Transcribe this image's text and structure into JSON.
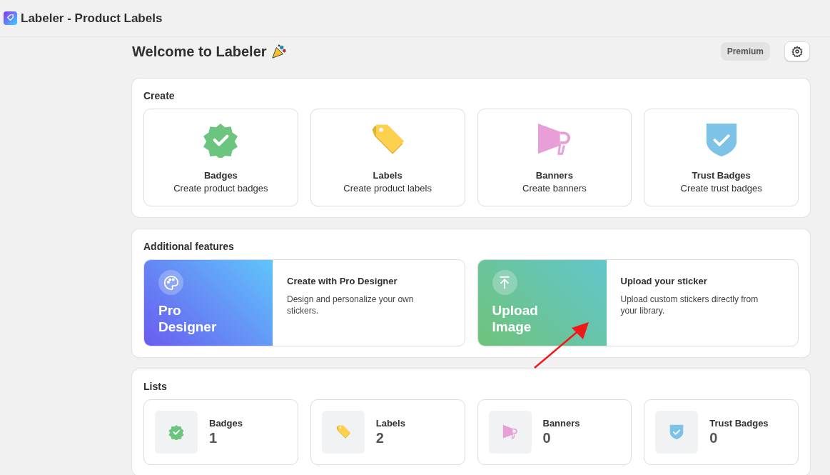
{
  "app_bar": {
    "title": "Labeler - Product Labels"
  },
  "header": {
    "title": "Welcome to Labeler",
    "plan_badge": "Premium"
  },
  "create": {
    "title": "Create",
    "items": [
      {
        "kind": "badge",
        "title": "Badges",
        "subtitle": "Create product badges"
      },
      {
        "kind": "label",
        "title": "Labels",
        "subtitle": "Create product labels"
      },
      {
        "kind": "banner",
        "title": "Banners",
        "subtitle": "Create banners"
      },
      {
        "kind": "trust",
        "title": "Trust Badges",
        "subtitle": "Create trust badges"
      }
    ]
  },
  "additional_features": {
    "title": "Additional features",
    "items": [
      {
        "kind": "designer",
        "tile_label": "Pro Designer",
        "title": "Create with Pro Designer",
        "description": "Design and personalize your own stickers."
      },
      {
        "kind": "upload",
        "tile_label": "Upload Image",
        "title": "Upload your sticker",
        "description": "Upload custom stickers directly from your library."
      }
    ]
  },
  "lists": {
    "title": "Lists",
    "items": [
      {
        "kind": "badge",
        "title": "Badges",
        "count": "1"
      },
      {
        "kind": "label",
        "title": "Labels",
        "count": "2"
      },
      {
        "kind": "banner",
        "title": "Banners",
        "count": "0"
      },
      {
        "kind": "trust",
        "title": "Trust Badges",
        "count": "0"
      }
    ]
  }
}
